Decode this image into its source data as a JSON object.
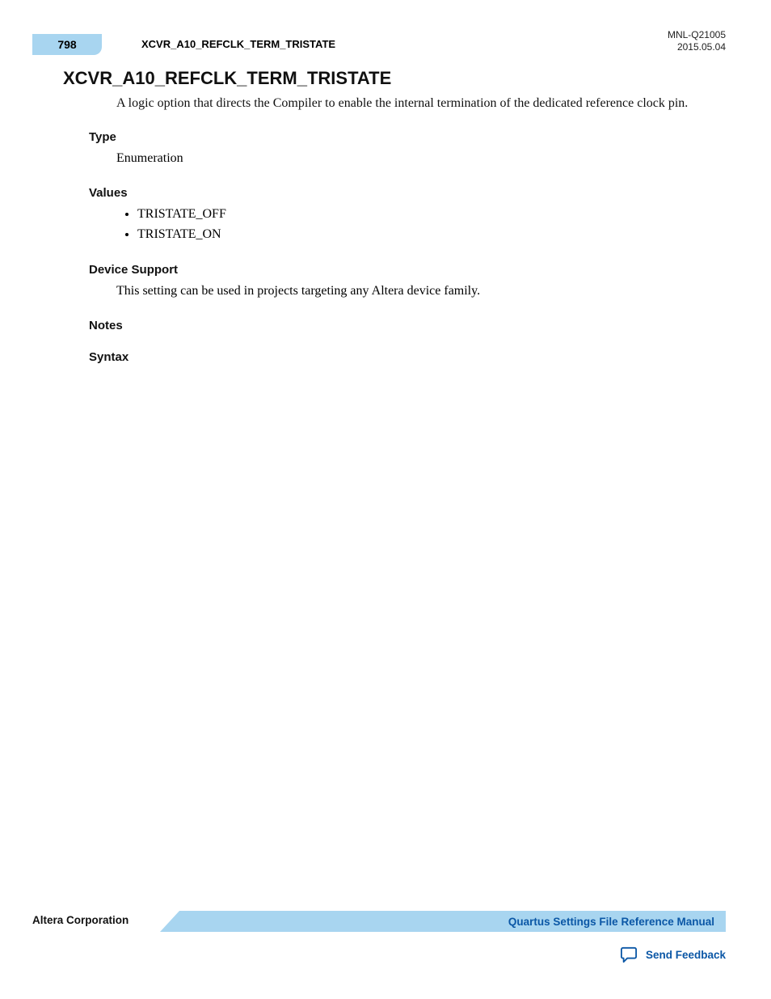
{
  "header": {
    "page_number": "798",
    "running_title": "XCVR_A10_REFCLK_TERM_TRISTATE",
    "doc_id": "MNL-Q21005",
    "doc_date": "2015.05.04"
  },
  "title": "XCVR_A10_REFCLK_TERM_TRISTATE",
  "intro": "A logic option that directs the Compiler to enable the internal termination of the dedicated reference clock pin.",
  "sections": {
    "type_label": "Type",
    "type_value": "Enumeration",
    "values_label": "Values",
    "values": [
      "TRISTATE_OFF",
      "TRISTATE_ON"
    ],
    "device_label": "Device Support",
    "device_value": "This setting can be used in projects targeting any Altera device family.",
    "notes_label": "Notes",
    "syntax_label": "Syntax"
  },
  "footer": {
    "corp": "Altera Corporation",
    "manual_link": "Quartus Settings File Reference Manual",
    "feedback": "Send Feedback"
  }
}
